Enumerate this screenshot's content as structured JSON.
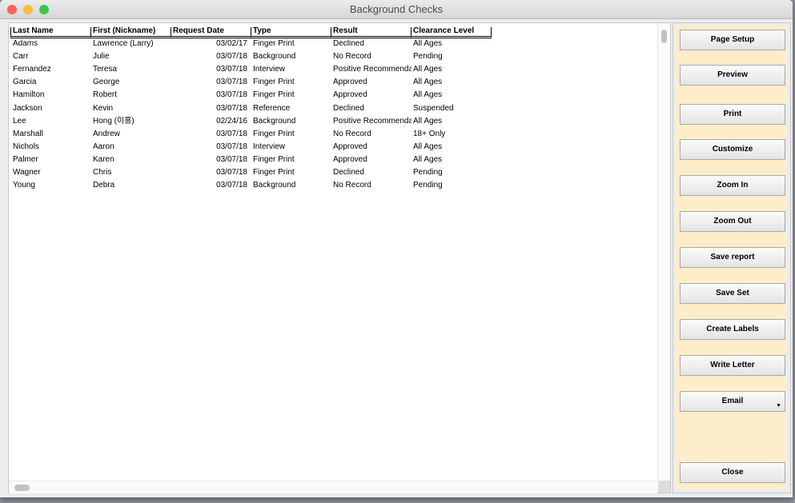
{
  "window": {
    "title": "Background Checks"
  },
  "colors": {
    "panel": "#fdedc9",
    "close": "#fc605b",
    "minimize": "#fdbc40",
    "zoom": "#34c84a"
  },
  "columns": [
    "Last Name",
    "First (Nickname)",
    "Request Date",
    "Type",
    "Result",
    "Clearance Level"
  ],
  "rows": [
    [
      "Adams",
      "Lawrence (Larry)",
      "03/02/17",
      "Finger Print",
      "Declined",
      "All Ages"
    ],
    [
      "Carr",
      "Julie",
      "03/07/18",
      "Background",
      "No Record",
      "Pending"
    ],
    [
      "Fernandez",
      "Teresa",
      "03/07/18",
      "Interview",
      "Positive Recommendation",
      "All Ages"
    ],
    [
      "Garcia",
      "George",
      "03/07/18",
      "Finger Print",
      "Approved",
      "All Ages"
    ],
    [
      "Hamilton",
      "Robert",
      "03/07/18",
      "Finger Print",
      "Approved",
      "All Ages"
    ],
    [
      "Jackson",
      "Kevin",
      "03/07/18",
      "Reference",
      "Declined",
      "Suspended"
    ],
    [
      "Lee",
      "Hong (이홍)",
      "02/24/16",
      "Background",
      "Positive Recommendation",
      "All Ages"
    ],
    [
      "Marshall",
      "Andrew",
      "03/07/18",
      "Finger Print",
      "No Record",
      "18+ Only"
    ],
    [
      "Nichols",
      "Aaron",
      "03/07/18",
      "Interview",
      "Approved",
      "All Ages"
    ],
    [
      "Palmer",
      "Karen",
      "03/07/18",
      "Finger Print",
      "Approved",
      "All Ages"
    ],
    [
      "Wagner",
      "Chris",
      "03/07/18",
      "Finger Print",
      "Declined",
      "Pending"
    ],
    [
      "Young",
      "Debra",
      "03/07/18",
      "Background",
      "No Record",
      "Pending"
    ]
  ],
  "buttons": [
    "Page Setup",
    "Preview",
    "Print",
    "Customize",
    "Zoom In",
    "Zoom Out",
    "Save report",
    "Save Set",
    "Create Labels",
    "Write Letter",
    "Email"
  ],
  "close_button": "Close"
}
